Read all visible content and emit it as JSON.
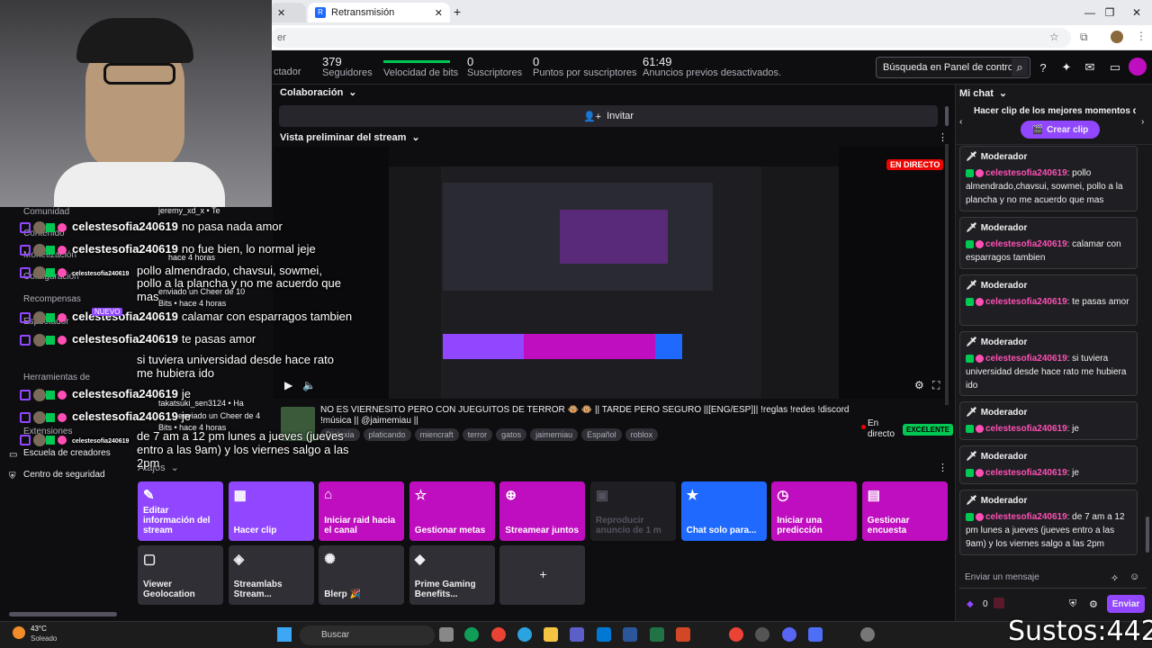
{
  "browser": {
    "tabs": [
      {
        "label": ""
      },
      {
        "label": "Retransmisión"
      }
    ],
    "url_partial": "er"
  },
  "stats": {
    "spectator_label": "ctador",
    "followers": {
      "value": "379",
      "label": "Seguidores"
    },
    "bits": {
      "label": "Velocidad de bits"
    },
    "subs": {
      "value": "0",
      "label": "Suscriptores"
    },
    "points": {
      "value": "0",
      "label": "Puntos por suscriptores"
    },
    "ads": {
      "value": "61:49",
      "label": "Anuncios previos desactivados."
    },
    "search_placeholder": "Búsqueda en Panel de control"
  },
  "collab": {
    "header": "Colaboración",
    "invite_label": "Invitar"
  },
  "preview": {
    "header": "Vista preliminar del stream",
    "live_badge": "EN DIRECTO"
  },
  "stream_info": {
    "title": "NO ES VIERNESITO PERO CON JUEGUITOS DE TERROR 🐵 🐵 || TARDE PERO SEGURO ||[ENG/ESP]|| !reglas !redes !discord !música || @jaimemiau ||",
    "tags": [
      "Dislexia",
      "platicando",
      "miencraft",
      "terror",
      "gatos",
      "jaimemiau",
      "Español",
      "roblox"
    ],
    "status": "En directo",
    "quality": "EXCELENTE"
  },
  "actions": {
    "header": "Atajos",
    "tiles": [
      {
        "label": "Editar información del stream"
      },
      {
        "label": "Hacer clip"
      },
      {
        "label": "Iniciar raid hacia el canal"
      },
      {
        "label": "Gestionar metas"
      },
      {
        "label": "Streamear juntos"
      },
      {
        "label": "Reproducir anuncio de 1 m"
      },
      {
        "label": "Chat solo para..."
      },
      {
        "label": "Iniciar una predicción"
      },
      {
        "label": "Gestionar encuesta"
      },
      {
        "label": "Viewer Geolocation"
      },
      {
        "label": "Streamlabs Stream..."
      },
      {
        "label": "Blerp 🎉"
      },
      {
        "label": "Prime Gaming Benefits..."
      },
      {
        "label": "+"
      }
    ]
  },
  "chat": {
    "header": "Mi chat",
    "clip_prompt": "Hacer clip de los mejores momentos de",
    "clip_button": "Crear clip",
    "mod_label": "Moderador",
    "messages": [
      {
        "user": "celestesofia240619",
        "text": ": pollo almendrado,chavsui, sowmei, pollo a la plancha y no me acuerdo que mas"
      },
      {
        "user": "celestesofia240619",
        "text": ": calamar con esparragos tambien"
      },
      {
        "user": "celestesofia240619",
        "text": ": te pasas amor"
      },
      {
        "user": "celestesofia240619",
        "text": ": si tuviera universidad desde hace rato me hubiera ido"
      },
      {
        "user": "celestesofia240619",
        "text": ": je"
      },
      {
        "user": "celestesofia240619",
        "text": ": je"
      },
      {
        "user": "celestesofia240619",
        "text": ": de 7 am a 12 pm lunes a jueves (jueves entro a las 9am) y los viernes salgo a las 2pm"
      }
    ],
    "input_placeholder": "Enviar un mensaje",
    "points": "0",
    "send_label": "Enviar"
  },
  "overlay": {
    "nav": [
      "Comunidad",
      "Contenido",
      "Monetización",
      "Configuración",
      "Recompensas",
      "Espectador",
      "Herramientas de",
      "Extensiones",
      "Escuela de creadores",
      "Centro de seguridad"
    ],
    "lines": [
      {
        "user": "celestesofia240619",
        "text": "no pasa nada amor"
      },
      {
        "user": "celestesofia240619",
        "text": "no fue bien, lo normal jeje"
      },
      {
        "user": "celestesofia240619",
        "text": ""
      },
      {
        "user": "",
        "text": "pollo almendrado, chavsui, sowmei,"
      },
      {
        "user": "",
        "text": "pollo a la plancha y no me acuerdo que"
      },
      {
        "user": "",
        "text": "mas"
      },
      {
        "user": "celestesofia240619",
        "text": "calamar con esparragos tambien"
      },
      {
        "user": "celestesofia240619",
        "text": "te pasas amor"
      },
      {
        "user": "",
        "text": "si tuviera universidad desde hace rato"
      },
      {
        "user": "",
        "text": "me hubiera ido"
      },
      {
        "user": "celestesofia240619",
        "text": "je"
      },
      {
        "user": "celestesofia240619",
        "text": "je"
      },
      {
        "user": "celestesofia240619",
        "text": ""
      },
      {
        "user": "",
        "text": "de 7 am a 12 pm lunes a jueves (jueves"
      },
      {
        "user": "",
        "text": "entro a las 9am) y los viernes salgo a las"
      },
      {
        "user": "",
        "text": "2pm"
      }
    ],
    "small_notes": [
      "jeremy_xd_x • Te",
      "hace 4 horas",
      "enviado un Cheer de 10",
      "Bits • hace 4 horas",
      "NUEVO",
      "takatsuki_sen3124 • Ha",
      "enviado un Cheer de 4",
      "Bits • hace 4 horas"
    ]
  },
  "taskbar": {
    "weather_temp": "43°C",
    "weather_text": "Soleado",
    "search": "Buscar"
  },
  "watermark": "Sustos:442"
}
